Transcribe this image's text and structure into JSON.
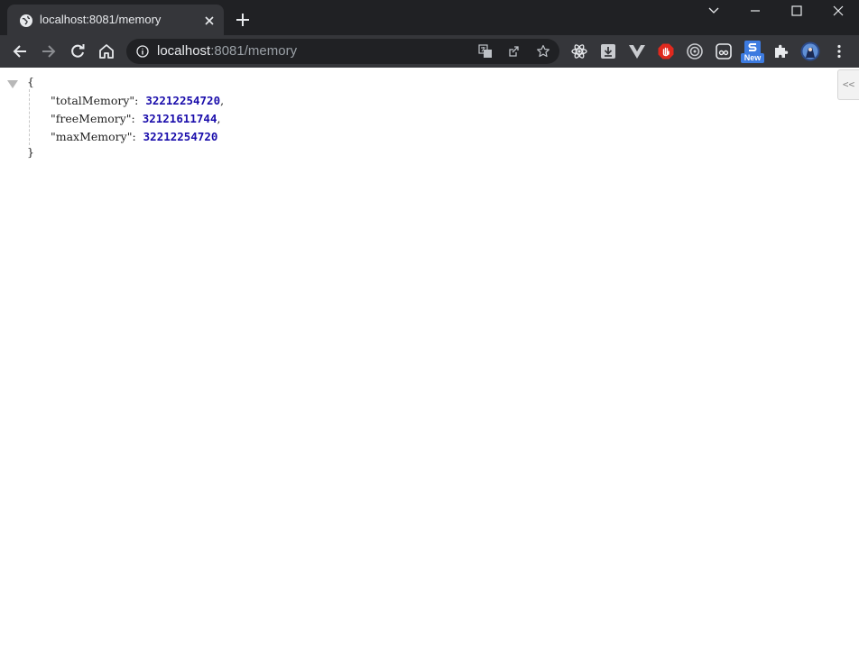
{
  "browser": {
    "tab": {
      "title": "localhost:8081/memory",
      "favicon": "globe-icon"
    },
    "omnibox": {
      "host": "localhost",
      "rest": ":8081/memory"
    },
    "extensions": [
      "react-devtools-icon",
      "download-icon",
      "vue-devtools-icon",
      "adblock-icon",
      "target-icon",
      "ghostery-icon",
      "new-extension-icon",
      "puzzle-icon",
      "profile-avatar"
    ],
    "new_badge": "New"
  },
  "json_viewer": {
    "open_brace": "{",
    "close_brace": "}",
    "side_handle": "<<",
    "rows": [
      {
        "key": "\"totalMemory\"",
        "value": "32212254720",
        "comma": ","
      },
      {
        "key": "\"freeMemory\"",
        "value": "32121611744",
        "comma": ","
      },
      {
        "key": "\"maxMemory\"",
        "value": "32212254720",
        "comma": ""
      }
    ]
  },
  "colors": {
    "titlebar": "#202124",
    "toolbar": "#35363a",
    "number": "#1a0dab"
  }
}
